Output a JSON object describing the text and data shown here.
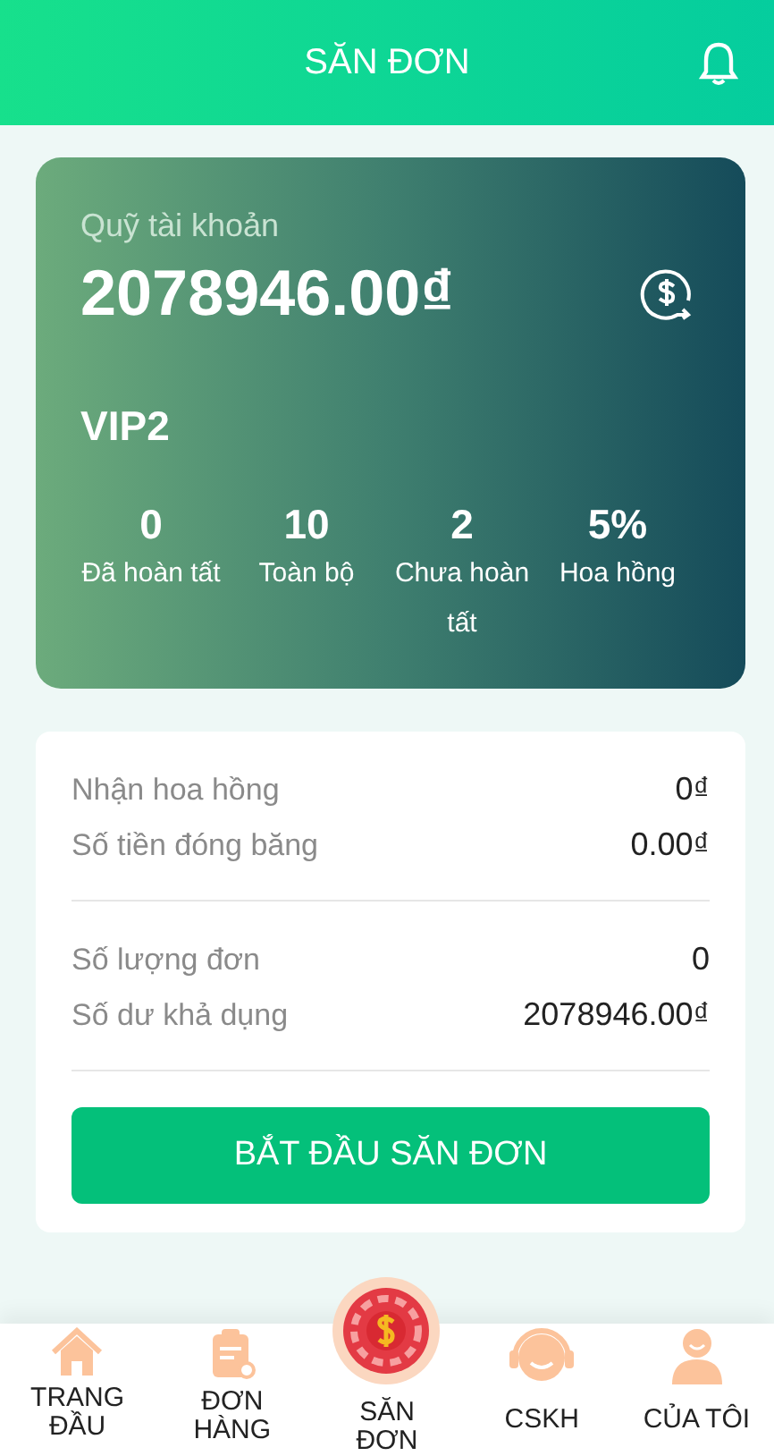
{
  "header": {
    "title": "SĂN ĐƠN"
  },
  "account": {
    "label": "Quỹ tài khoản",
    "balance": "2078946.00₫",
    "level": "VIP2",
    "stats": [
      {
        "value": "0",
        "label": "Đã hoàn tất"
      },
      {
        "value": "10",
        "label": "Toàn bộ"
      },
      {
        "value": "2",
        "label": "Chưa hoàn tất"
      },
      {
        "value": "5%",
        "label": "Hoa hồng"
      }
    ]
  },
  "details": [
    [
      {
        "label": "Nhận hoa hồng",
        "value": "0₫"
      },
      {
        "label": "Số tiền đóng băng",
        "value": "0.00₫"
      }
    ],
    [
      {
        "label": "Số lượng đơn",
        "value": "0"
      },
      {
        "label": "Số dư khả dụng",
        "value": "2078946.00₫"
      }
    ]
  ],
  "start_button": "BẮT ĐẦU SĂN ĐƠN",
  "tabs": [
    {
      "kind": "home",
      "label": "TRANG ĐẦU"
    },
    {
      "kind": "orders",
      "label": "ĐƠN HÀNG"
    },
    {
      "kind": "center",
      "label": "SĂN ĐƠN"
    },
    {
      "kind": "support",
      "label": "CSKH"
    },
    {
      "kind": "profile",
      "label": "CỦA TÔI"
    }
  ]
}
